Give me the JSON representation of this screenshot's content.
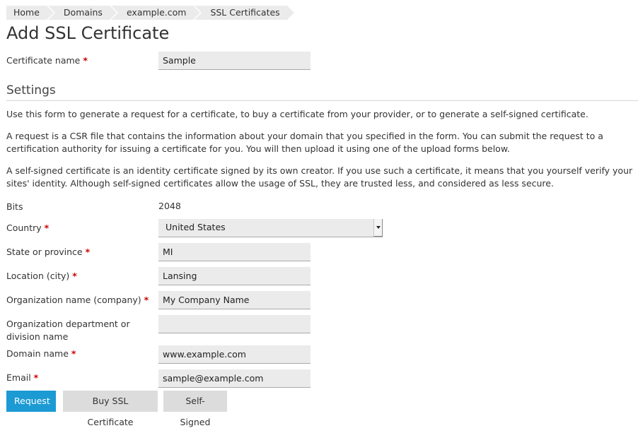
{
  "breadcrumb": [
    {
      "label": "Home"
    },
    {
      "label": "Domains"
    },
    {
      "label": "example.com"
    },
    {
      "label": "SSL Certificates"
    }
  ],
  "page_title": "Add SSL Certificate",
  "required_marker": "*",
  "certificate_name": {
    "label": "Certificate name",
    "value": "Sample"
  },
  "settings": {
    "heading": "Settings",
    "paragraphs": [
      "Use this form to generate a request for a certificate, to buy a certificate from your provider, or to generate a self-signed certificate.",
      "A request is a CSR file that contains the information about your domain that you specified in the form. You can submit the request to a certification authority for issuing a certificate for you. You will then upload it using one of the upload forms below.",
      "A self-signed certificate is an identity certificate signed by its own creator. If you use such a certificate, it means that you yourself verify your sites' identity. Although self-signed certificates allow the usage of SSL, they are trusted less, and considered as less secure."
    ]
  },
  "fields": {
    "bits": {
      "label": "Bits",
      "value": "2048"
    },
    "country": {
      "label": "Country",
      "value": "United States"
    },
    "state": {
      "label": "State or province",
      "value": "MI"
    },
    "city": {
      "label": "Location (city)",
      "value": "Lansing"
    },
    "org_name": {
      "label": "Organization name (company)",
      "value": "My Company Name"
    },
    "org_dept": {
      "label": "Organization department or division name",
      "value": ""
    },
    "domain": {
      "label": "Domain name",
      "value": "www.example.com"
    },
    "email": {
      "label": "Email",
      "value": "sample@example.com"
    }
  },
  "buttons": {
    "request": "Request",
    "buy": "Buy SSL Certificate",
    "self_signed": "Self-Signed"
  },
  "colors": {
    "primary": "#1c9ad4",
    "required": "#cc0000"
  }
}
